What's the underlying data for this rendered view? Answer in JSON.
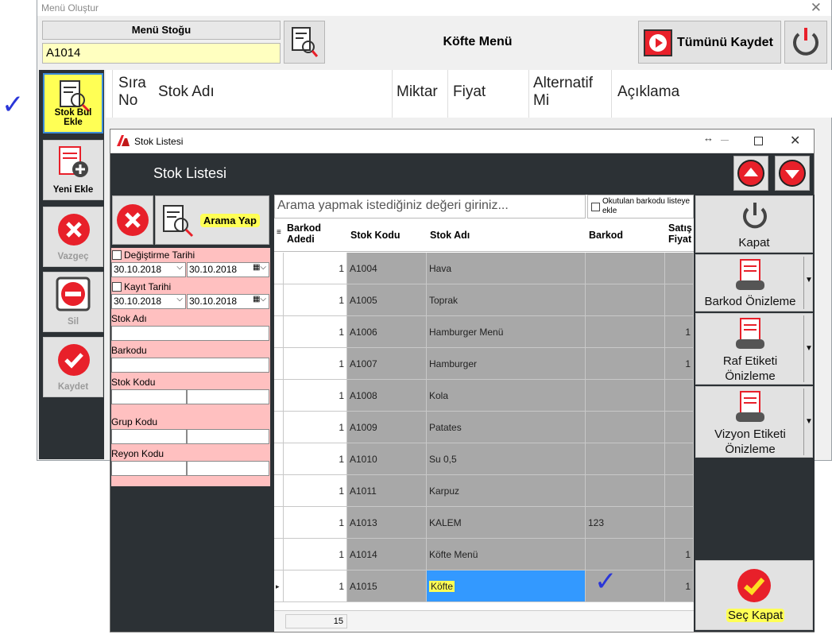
{
  "main_window": {
    "title": "Menü Oluştur",
    "menu_stock_label": "Menü Stoğu",
    "menu_stock_value": "A1014",
    "menu_name": "Köfte Menü",
    "save_all_label": "Tümünü Kaydet"
  },
  "sidebar": {
    "items": [
      {
        "label": "Stok Bul Ekle"
      },
      {
        "label": "Yeni Ekle"
      },
      {
        "label": "Vazgeç"
      },
      {
        "label": "Sil"
      },
      {
        "label": "Kaydet"
      }
    ]
  },
  "main_table": {
    "headers": [
      "Sıra\nNo",
      "Stok Adı",
      "Miktar",
      "Fiyat",
      "Alternatif\nMi",
      "Açıklama"
    ]
  },
  "dialog": {
    "title": "Stok Listesi",
    "heading": "Stok Listesi",
    "resize_glyph": "↔",
    "search_button_label": "Arama Yap",
    "search_placeholder": "Arama yapmak istediğiniz değeri giriniz...",
    "barcode_checkbox_label": "Okutulan barkodu listeye ekle",
    "filters": {
      "change_date_label": "Değiştirme Tarihi",
      "change_date_from": "30.10.2018",
      "change_date_to": "30.10.2018",
      "record_date_label": "Kayıt Tarihi",
      "record_date_from": "30.10.2018",
      "record_date_to": "30.10.2018",
      "stock_name_label": "Stok Adı",
      "barcode_label": "Barkodu",
      "stock_code_label": "Stok Kodu",
      "group_code_label": "Grup Kodu",
      "shelf_code_label": "Reyon Kodu"
    },
    "grid": {
      "headers": [
        "Barkod Adedi",
        "Stok Kodu",
        "Stok Adı",
        "Barkod",
        "Satış Fiyatı"
      ],
      "header_truncated": "Satış\nFiyat",
      "rows": [
        {
          "qty": "1",
          "code": "A1004",
          "name": "Hava",
          "barcode": "",
          "price": ""
        },
        {
          "qty": "1",
          "code": "A1005",
          "name": "Toprak",
          "barcode": "",
          "price": ""
        },
        {
          "qty": "1",
          "code": "A1006",
          "name": "Hamburger Menü",
          "barcode": "",
          "price": "1"
        },
        {
          "qty": "1",
          "code": "A1007",
          "name": "Hamburger",
          "barcode": "",
          "price": "1"
        },
        {
          "qty": "1",
          "code": "A1008",
          "name": "Kola",
          "barcode": "",
          "price": ""
        },
        {
          "qty": "1",
          "code": "A1009",
          "name": "Patates",
          "barcode": "",
          "price": ""
        },
        {
          "qty": "1",
          "code": "A1010",
          "name": "Su 0,5",
          "barcode": "",
          "price": ""
        },
        {
          "qty": "1",
          "code": "A1011",
          "name": "Karpuz",
          "barcode": "",
          "price": ""
        },
        {
          "qty": "1",
          "code": "A1013",
          "name": "KALEM",
          "barcode": "123",
          "price": ""
        },
        {
          "qty": "1",
          "code": "A1014",
          "name": "Köfte Menü",
          "barcode": "",
          "price": "1"
        },
        {
          "qty": "1",
          "code": "A1015",
          "name": "Köfte",
          "barcode": "",
          "price": "1"
        }
      ],
      "footer_count": "15"
    },
    "right_buttons": {
      "close_label": "Kapat",
      "barcode_preview_label": "Barkod Önizleme",
      "shelf_label_preview_label": "Raf Etiketi\nÖnizleme",
      "vision_label_preview_label": "Vizyon Etiketi\nÖnizleme",
      "select_close_label": "Seç Kapat"
    }
  },
  "colors": {
    "accent_red": "#e8202a",
    "dark_panel": "#2c3135",
    "filter_pink": "#ffc0c0",
    "selection_blue": "#3399ff",
    "highlight_yellow": "#ffff55"
  }
}
